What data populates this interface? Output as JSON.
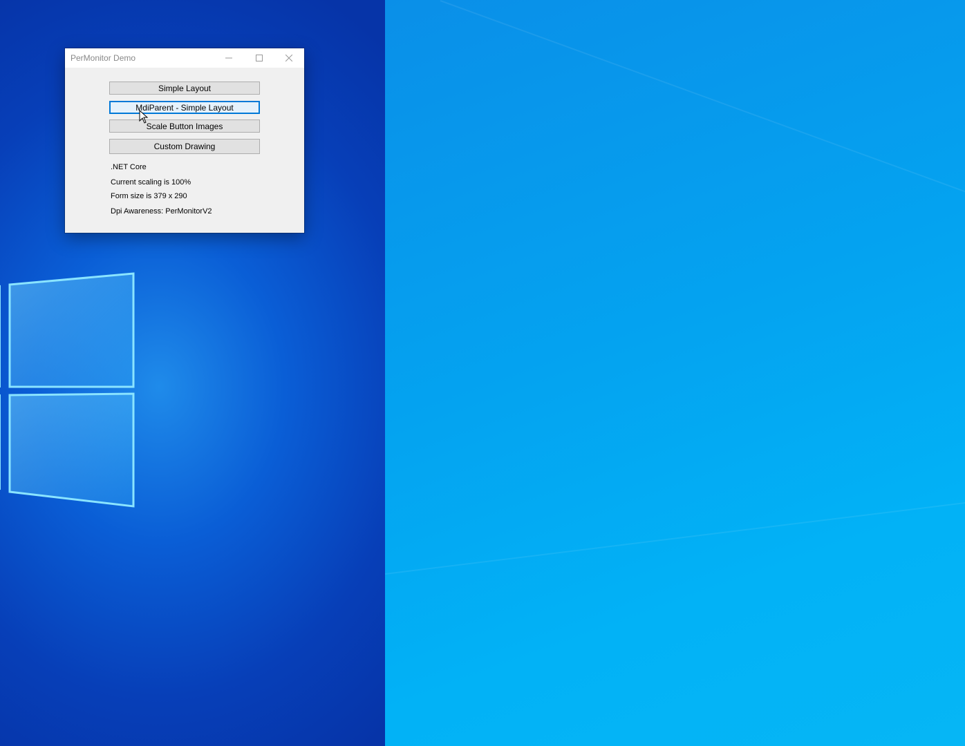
{
  "window": {
    "title": "PerMonitor Demo",
    "buttons": [
      {
        "label": "Simple Layout"
      },
      {
        "label": "MdiParent - Simple Layout"
      },
      {
        "label": "Scale Button Images"
      },
      {
        "label": "Custom Drawing"
      }
    ],
    "info": {
      "runtime": ".NET Core",
      "scaling": "Current scaling is 100%",
      "form_size": "Form size is 379 x 290",
      "dpi_awareness": "Dpi Awareness: PerMonitorV2"
    }
  },
  "icons": {
    "minimize": "minimize-icon",
    "maximize": "maximize-icon",
    "close": "close-icon",
    "logo": "windows-logo",
    "cursor": "mouse-pointer-icon"
  },
  "colors": {
    "accent": "#0078d7",
    "window_bg": "#f0f0f0",
    "desktop_left": "#0a4fc4",
    "desktop_right": "#04a8f2"
  }
}
